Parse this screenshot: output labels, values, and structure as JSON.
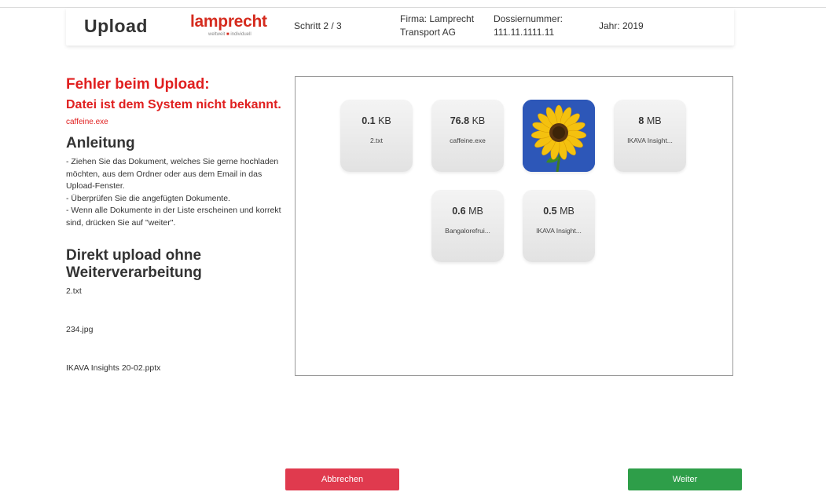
{
  "header": {
    "title": "Upload",
    "logo_word": "lamprecht",
    "logo_tag_left": "weltweit",
    "logo_tag_sep": "■",
    "logo_tag_right": "individuell",
    "step": "Schritt 2 / 3",
    "firma_line1": "Firma: Lamprecht",
    "firma_line2": "Transport AG",
    "dossier_label": "Dossiernummer:",
    "dossier_value": "111.11.1111.11",
    "year": "Jahr: 2019"
  },
  "error": {
    "heading": "Fehler beim Upload:",
    "message": "Datei ist dem System nicht bekannt.",
    "file": "caffeine.exe"
  },
  "instructions": {
    "heading": "Anleitung",
    "lines": [
      "- Ziehen Sie das Dokument, welches Sie gerne hochladen möchten, aus dem Ordner oder aus dem Email in das Upload-Fenster.",
      "- Überprüfen Sie die angefügten Dokumente.",
      "- Wenn alle Dokumente in der Liste erscheinen und korrekt sind, drücken Sie auf \"weiter\"."
    ]
  },
  "direct_upload": {
    "heading": "Direkt upload ohne Weiterverarbeitung",
    "files": [
      "2.txt",
      "234.jpg",
      "IKAVA Insights 20-02.pptx"
    ]
  },
  "tiles": [
    {
      "size": "0.1",
      "unit": "KB",
      "name": "2.txt"
    },
    {
      "size": "76.8",
      "unit": "KB",
      "name": "caffeine.exe"
    },
    {
      "image": "sunflower"
    },
    {
      "size": "8",
      "unit": "MB",
      "name": "IKAVA Insight..."
    },
    {
      "size": "0.6",
      "unit": "MB",
      "name": "Bangalorefrui..."
    },
    {
      "size": "0.5",
      "unit": "MB",
      "name": "IKAVA Insight..."
    }
  ],
  "buttons": {
    "cancel": "Abbrechen",
    "next": "Weiter"
  },
  "colors": {
    "error": "#e02020",
    "brand": "#d52b1e",
    "cancel": "#e03a4e",
    "next": "#2e9e49"
  }
}
